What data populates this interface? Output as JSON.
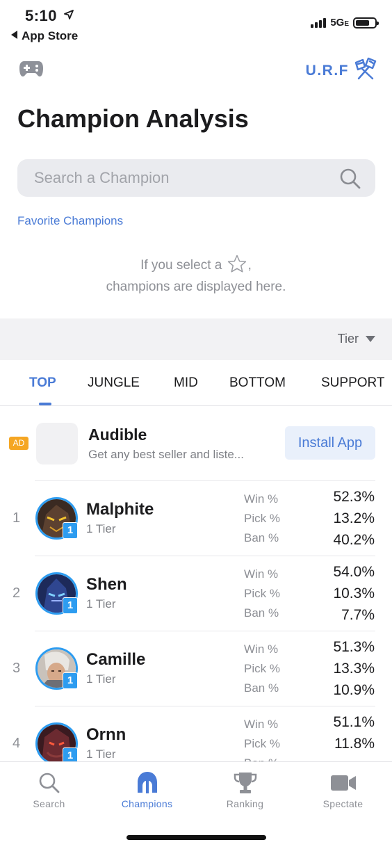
{
  "status_bar": {
    "time": "5:10",
    "back_label": "App Store",
    "network": "5G",
    "network_suffix": "E"
  },
  "header": {
    "left_icon": "gamepad-icon",
    "mode_label": "U.R.F",
    "mode_icon": "urf-spatula-icon",
    "title": "Champion Analysis"
  },
  "search": {
    "placeholder": "Search a Champion",
    "value": ""
  },
  "favorites": {
    "title": "Favorite Champions",
    "empty_line1_before": "If you select a",
    "empty_line1_after": ",",
    "empty_line2": "champions are displayed here."
  },
  "sort": {
    "selected": "Tier"
  },
  "role_tabs": [
    {
      "label": "TOP",
      "active": true
    },
    {
      "label": "JUNGLE",
      "active": false
    },
    {
      "label": "MID",
      "active": false
    },
    {
      "label": "BOTTOM",
      "active": false
    },
    {
      "label": "SUPPORT",
      "active": false
    }
  ],
  "ad": {
    "badge": "AD",
    "title": "Audible",
    "subtitle": "Get any best seller and liste...",
    "button": "Install App"
  },
  "stat_labels": {
    "win": "Win %",
    "pick": "Pick %",
    "ban": "Ban %"
  },
  "champions": [
    {
      "rank": "1",
      "name": "Malphite",
      "tier": "1 Tier",
      "tier_badge": "1",
      "win": "52.3%",
      "pick": "13.2%",
      "ban": "40.2%"
    },
    {
      "rank": "2",
      "name": "Shen",
      "tier": "1 Tier",
      "tier_badge": "1",
      "win": "54.0%",
      "pick": "10.3%",
      "ban": "7.7%"
    },
    {
      "rank": "3",
      "name": "Camille",
      "tier": "1 Tier",
      "tier_badge": "1",
      "win": "51.3%",
      "pick": "13.3%",
      "ban": "10.9%"
    },
    {
      "rank": "4",
      "name": "Ornn",
      "tier": "1 Tier",
      "tier_badge": "1",
      "win": "51.1%",
      "pick": "11.8%",
      "ban": ""
    }
  ],
  "tabbar": [
    {
      "label": "Search",
      "icon": "search-icon",
      "active": false
    },
    {
      "label": "Champions",
      "icon": "helmet-icon",
      "active": true
    },
    {
      "label": "Ranking",
      "icon": "trophy-icon",
      "active": false
    },
    {
      "label": "Spectate",
      "icon": "video-camera-icon",
      "active": false
    }
  ],
  "colors": {
    "accent": "#4a7bd6",
    "tier_badge": "#2d9cf0",
    "ad_badge": "#f5a623"
  }
}
